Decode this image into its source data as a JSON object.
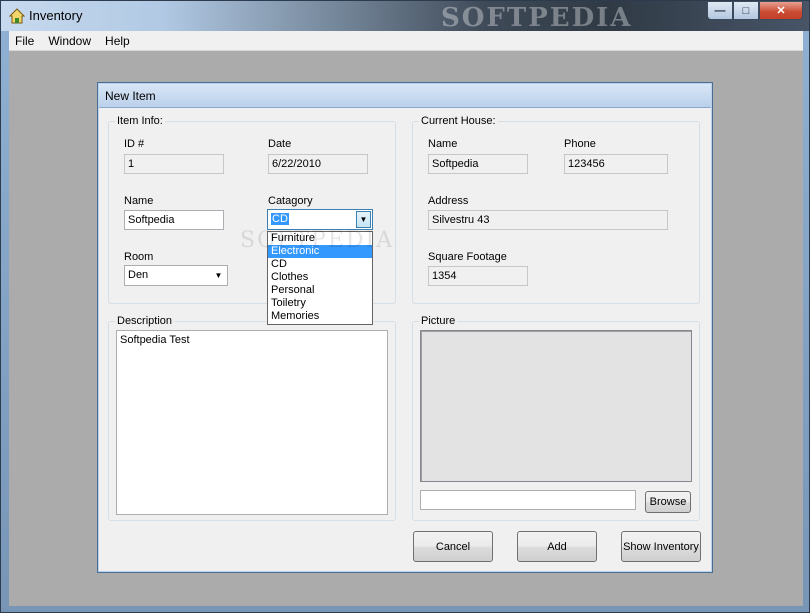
{
  "window": {
    "title": "Inventory",
    "watermark": "SOFTPEDIA",
    "buttons": {
      "minimize": "—",
      "maximize": "□",
      "close": "✕"
    }
  },
  "menu": [
    "File",
    "Window",
    "Help"
  ],
  "dialog": {
    "title": "New Item",
    "item_info": {
      "group_label": "Item Info:",
      "id_label": "ID #",
      "id_value": "1",
      "date_label": "Date",
      "date_value": "6/22/2010",
      "name_label": "Name",
      "name_value": "Softpedia",
      "category_label": "Catagory",
      "category_value": "CD",
      "category_options": [
        "Furniture",
        "Electronic",
        "CD",
        "Clothes",
        "Personal",
        "Toiletry",
        "Memories"
      ],
      "category_highlighted": "Electronic",
      "room_label": "Room",
      "room_value": "Den"
    },
    "current_house": {
      "group_label": "Current House:",
      "name_label": "Name",
      "name_value": "Softpedia",
      "phone_label": "Phone",
      "phone_value": "123456",
      "address_label": "Address",
      "address_value": "Silvestru 43",
      "sqft_label": "Square Footage",
      "sqft_value": "1354"
    },
    "description": {
      "group_label": "Description",
      "value": "Softpedia Test"
    },
    "picture": {
      "group_label": "Picture",
      "path_value": "",
      "browse_label": "Browse"
    },
    "buttons": {
      "cancel": "Cancel",
      "add": "Add",
      "show_inventory": "Show Inventory"
    },
    "dropdown_watermark": "SOFTPEDIA"
  },
  "colors": {
    "selection": "#3399ff",
    "dialog_bg": "#f0f0f0",
    "mdi_bg": "#ababab"
  }
}
